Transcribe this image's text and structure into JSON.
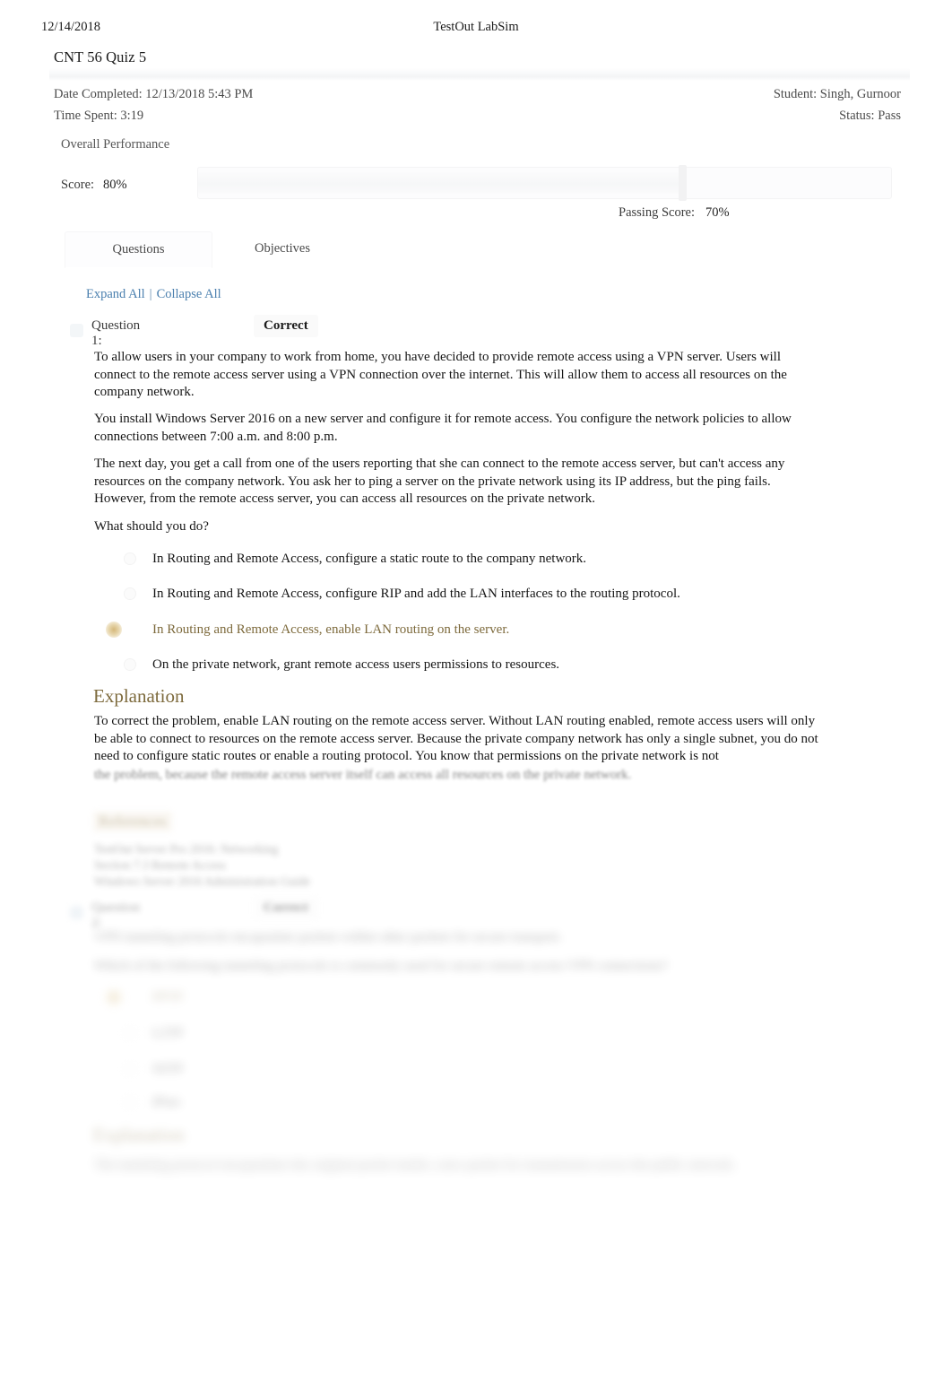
{
  "print_header": {
    "date": "12/14/2018",
    "app_title": "TestOut LabSim"
  },
  "quiz": {
    "title": "CNT 56 Quiz 5",
    "date_completed_label": "Date Completed: 12/13/2018 5:43 PM",
    "time_spent_label": "Time Spent: 3:19",
    "student_label": "Student: Singh, Gurnoor",
    "status_label": "Status: Pass"
  },
  "performance": {
    "section_label": "Overall Performance",
    "score_label": "Score:",
    "score_value": "80%",
    "passing_label": "Passing Score:",
    "passing_value": "70%",
    "score_percent": 80,
    "passing_percent": 70
  },
  "tabs": [
    {
      "label": "Questions",
      "active": true
    },
    {
      "label": "Objectives",
      "active": false
    }
  ],
  "controls": {
    "expand_all": "Expand All",
    "separator": "|",
    "collapse_all": "Collapse All"
  },
  "questions": [
    {
      "label": "Question 1:",
      "status": "Correct",
      "paragraphs": [
        "To allow users in your company to work from home, you have decided to provide remote access using a VPN server. Users will connect to the remote access server using a VPN connection over the internet. This will allow them to access all resources on the company network.",
        "You install Windows Server 2016 on a new server and configure it for remote access. You configure the network policies to allow connections between 7:00 a.m. and 8:00 p.m.",
        "The next day, you get a call from one of the users reporting that she can connect to the remote access server, but can't access any resources on the company network. You ask her to ping a server on the private network using its IP address, but the ping fails. However, from the remote access server, you can access all resources on the private network.",
        "What should you do?"
      ],
      "options": [
        {
          "text": "In Routing and Remote Access, configure a static route to the company network.",
          "selected": false
        },
        {
          "text": "In Routing and Remote Access, configure RIP and add the LAN interfaces to the routing protocol.",
          "selected": false
        },
        {
          "text": "In Routing and Remote Access, enable LAN routing on the server.",
          "selected": true
        },
        {
          "text": "On the private network, grant remote access users permissions to resources.",
          "selected": false
        }
      ],
      "explanation_heading": "Explanation",
      "explanation_text": "To correct the problem, enable LAN routing on the remote access server. Without LAN routing enabled, remote access users will only be able to connect to resources on the remote access server. Because the private company network has only a single subnet, you do not need to configure static routes or enable a routing protocol. You know that permissions on the private network is not",
      "explanation_text_faded": "the problem, because the remote access server itself can access all resources on the private network.",
      "references_heading": "References",
      "references": [
        "TestOut Server Pro 2016: Networking",
        "Section 7.3 Remote Access",
        "Windows Server 2016 Administration Guide"
      ]
    },
    {
      "label": "Question 2:",
      "status": "Correct",
      "paragraphs": [
        "VPN tunneling protocols encapsulate packets within other packets for secure transport.",
        "Which of the following tunneling protocols is commonly used for secure remote access VPN connections?"
      ],
      "options": [
        {
          "text": "PPTP",
          "selected": false
        },
        {
          "text": "L2TP",
          "selected": false
        },
        {
          "text": "SSTP",
          "selected": false
        },
        {
          "text": "IPsec",
          "selected": true
        }
      ],
      "explanation_heading": "Explanation",
      "explanation_text": "The tunneling protocol encapsulates the original packet inside a new packet for transmission across the public network."
    }
  ]
}
